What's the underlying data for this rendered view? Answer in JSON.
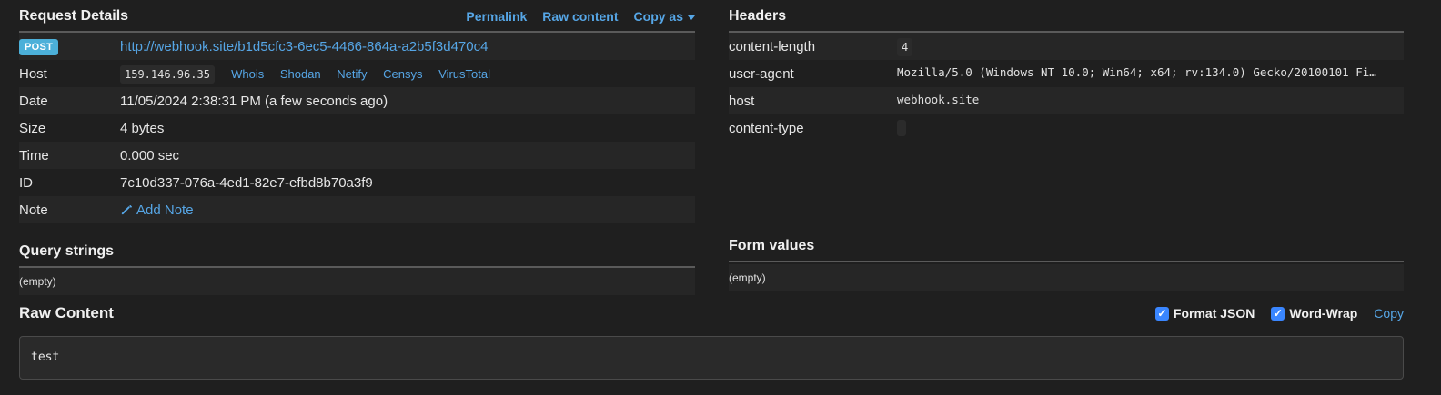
{
  "request_details": {
    "title": "Request Details",
    "links": [
      "Permalink",
      "Raw content",
      "Copy as"
    ],
    "method": "POST",
    "url": "http://webhook.site/b1d5cfc3-6ec5-4466-864a-a2b5f3d470c4",
    "rows": {
      "host_label": "Host",
      "host_ip": "159.146.96.35",
      "host_links": [
        "Whois",
        "Shodan",
        "Netify",
        "Censys",
        "VirusTotal"
      ],
      "date_label": "Date",
      "date_value": "11/05/2024 2:38:31 PM (a few seconds ago)",
      "size_label": "Size",
      "size_value": "4 bytes",
      "time_label": "Time",
      "time_value": "0.000 sec",
      "id_label": "ID",
      "id_value": "7c10d337-076a-4ed1-82e7-efbd8b70a3f9",
      "note_label": "Note",
      "note_action": "Add Note"
    }
  },
  "headers": {
    "title": "Headers",
    "items": [
      {
        "key": "content-length",
        "value": "4"
      },
      {
        "key": "user-agent",
        "value": "Mozilla/5.0 (Windows NT 10.0; Win64; x64; rv:134.0) Gecko/20100101 Fi…"
      },
      {
        "key": "host",
        "value": "webhook.site"
      },
      {
        "key": "content-type",
        "value": ""
      }
    ]
  },
  "query_strings": {
    "title": "Query strings",
    "empty": "(empty)"
  },
  "form_values": {
    "title": "Form values",
    "empty": "(empty)"
  },
  "raw_content": {
    "title": "Raw Content",
    "format_json": "Format JSON",
    "word_wrap": "Word-Wrap",
    "copy": "Copy",
    "body": "test"
  }
}
